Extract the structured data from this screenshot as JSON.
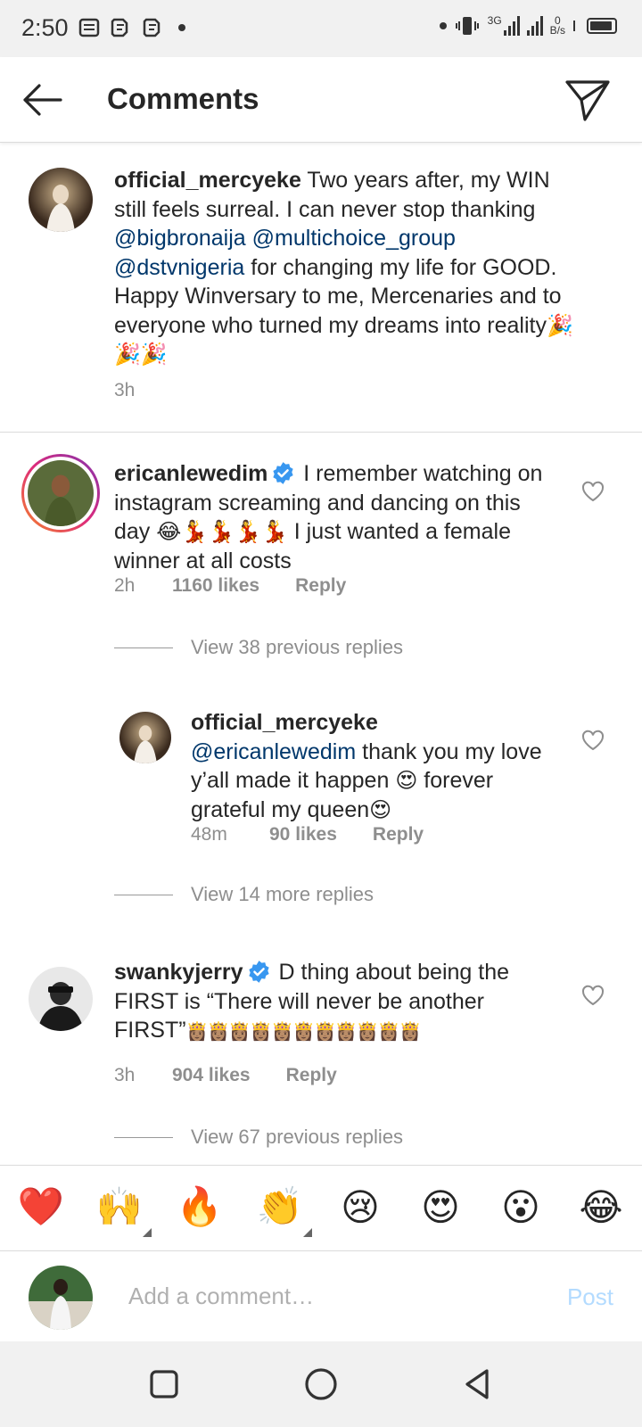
{
  "status_bar": {
    "time": "2:50",
    "network_type": "3G",
    "speed_value": "0",
    "speed_unit": "B/s"
  },
  "header": {
    "title": "Comments"
  },
  "caption": {
    "username": "official_mercyeke",
    "text_1": " Two years after, my WIN still feels surreal. I can never stop thanking ",
    "mention_1": "@bigbronaija",
    "text_2": " ",
    "mention_2": "@multichoice_group",
    "text_3": " ",
    "mention_3": "@dstvnigeria",
    "text_4": " for changing my life for GOOD. Happy Winversary to me, Mercenaries  and to everyone who turned my  dreams into reality",
    "emojis": "🎉🎉🎉",
    "time": "3h"
  },
  "comments": [
    {
      "username": "ericanlewedim",
      "verified": true,
      "text": " I remember watching on instagram screaming and dancing on this day ",
      "emojis": "😂💃💃💃💃",
      "text_after": " I just wanted a female winner at all costs",
      "time": "2h",
      "likes": "1160 likes",
      "reply": "Reply",
      "view_replies": "View 38 previous replies"
    },
    {
      "username": "official_mercyeke",
      "mention": "@ericanlewedim",
      "text": " thank you my love y’all made it happen ",
      "emoji_1": "😍",
      "text_after": " forever grateful my queen",
      "emoji_2": "😍",
      "time": "48m",
      "likes": "90 likes",
      "reply": "Reply",
      "view_replies": "View 14 more replies"
    },
    {
      "username": "swankyjerry",
      "verified": true,
      "text": " D thing about being the FIRST is “There will never be another FIRST”",
      "emojis": "👸🏽👸🏽👸🏽👸🏽👸🏽👸🏽👸🏽👸🏽👸🏽👸🏽👸🏽",
      "time": "3h",
      "likes": "904 likes",
      "reply": "Reply",
      "view_replies": "View 67 previous replies"
    }
  ],
  "emoji_bar": [
    "❤️",
    "🙌",
    "🔥",
    "👏",
    "😢",
    "😍",
    "😮",
    "😂"
  ],
  "composer": {
    "placeholder": "Add a comment…",
    "post_label": "Post"
  },
  "colors": {
    "mention": "#00376b",
    "meta": "#8e8e8e",
    "post_disabled": "#b3dbff",
    "verified": "#3897f0",
    "story_ring_start": "#f58529",
    "story_ring_end": "#c13584"
  },
  "icons": {
    "back": "arrow-left-icon",
    "send": "paper-plane-icon",
    "like": "heart-outline-icon",
    "verified": "verified-badge-icon"
  }
}
